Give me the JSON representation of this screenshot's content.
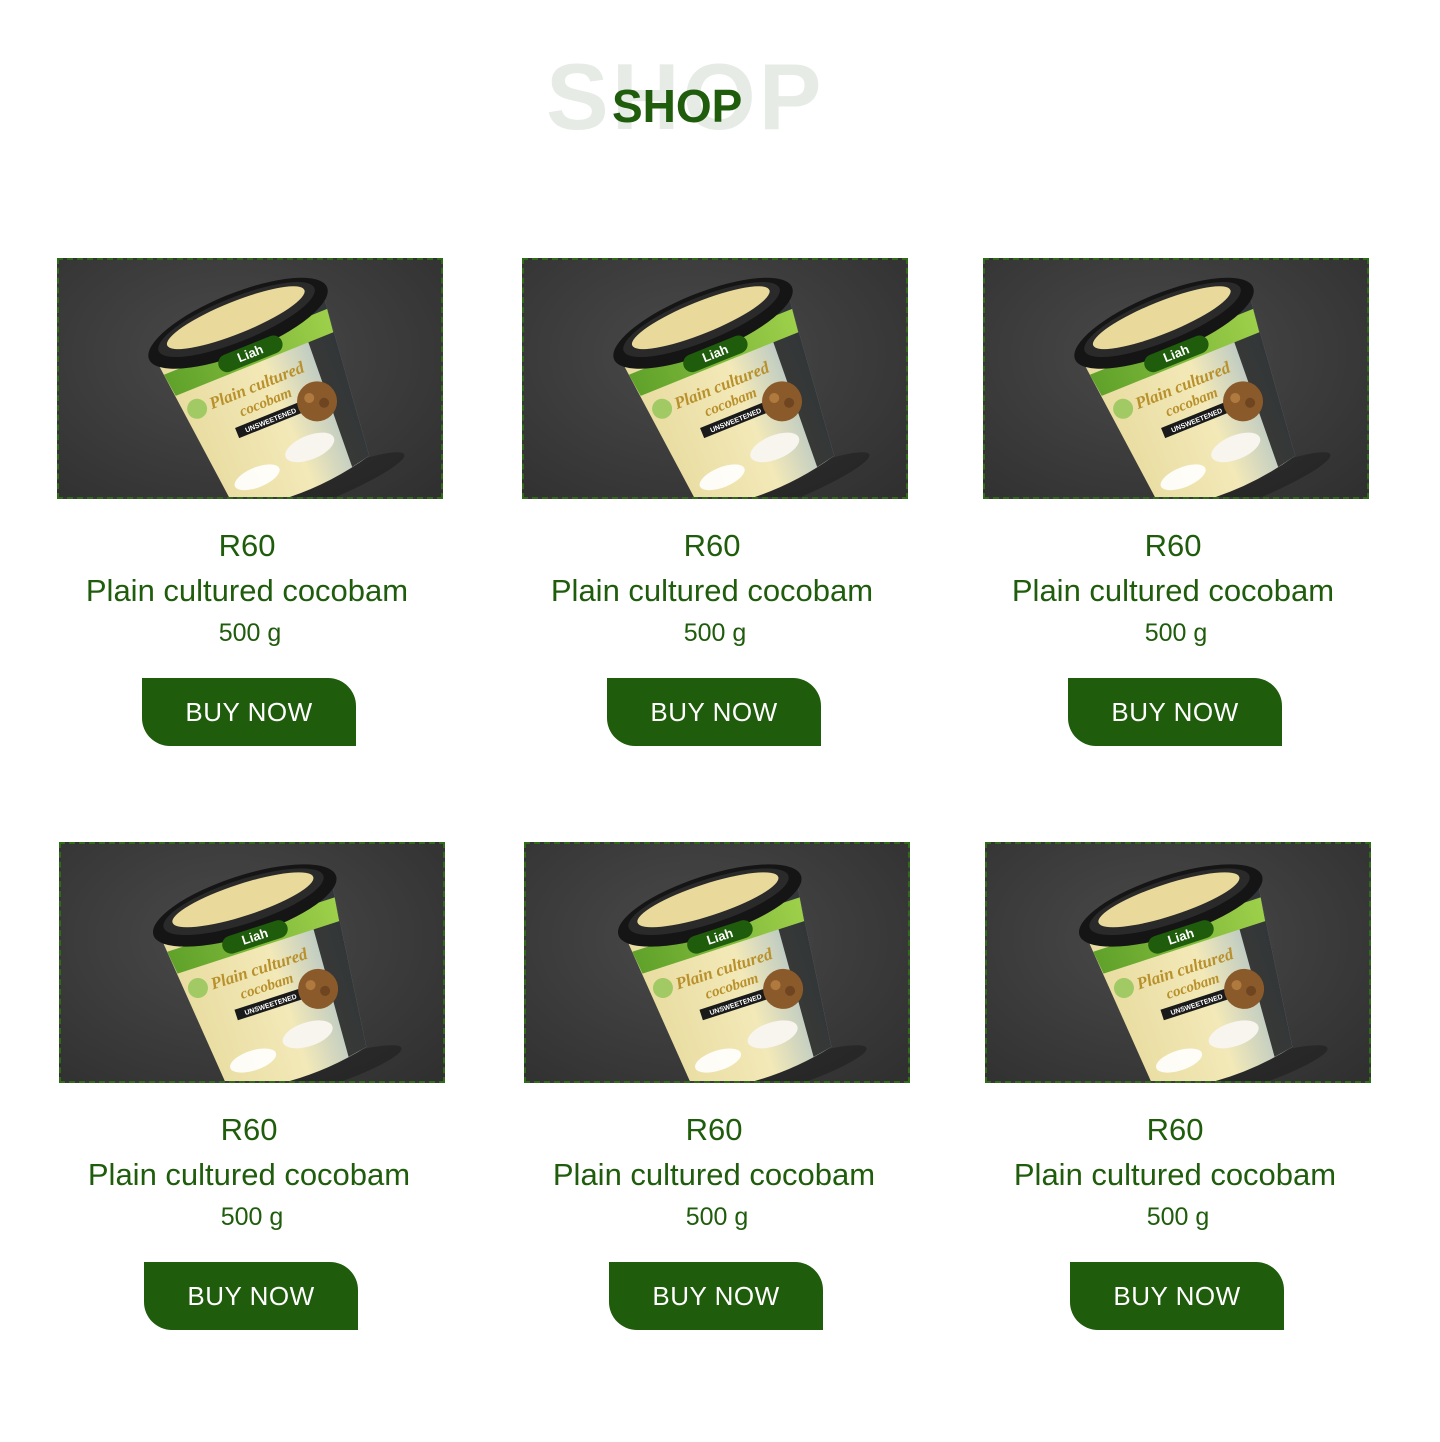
{
  "header": {
    "title_bg": "SHOP",
    "title": "SHOP"
  },
  "products": [
    {
      "price": "R60",
      "name": "Plain cultured cocobam",
      "weight": "500 g",
      "button": "BUY NOW"
    },
    {
      "price": "R60",
      "name": "Plain cultured cocobam",
      "weight": "500 g",
      "button": "BUY NOW"
    },
    {
      "price": "R60",
      "name": "Plain cultured cocobam",
      "weight": "500 g",
      "button": "BUY NOW"
    },
    {
      "price": "R60",
      "name": "Plain cultured cocobam",
      "weight": "500 g",
      "button": "BUY NOW"
    },
    {
      "price": "R60",
      "name": "Plain cultured cocobam",
      "weight": "500 g",
      "button": "BUY NOW"
    },
    {
      "price": "R60",
      "name": "Plain cultured cocobam",
      "weight": "500 g",
      "button": "BUY NOW"
    }
  ],
  "product_image": {
    "brand": "Liah",
    "label_line1": "Plain cultured",
    "label_line2": "cocobam",
    "badge": "UNSWEETENED"
  },
  "colors": {
    "brand_green": "#1f5c0c",
    "faded_title": "#e6ebe6",
    "image_bg": "#3b3b3b"
  }
}
